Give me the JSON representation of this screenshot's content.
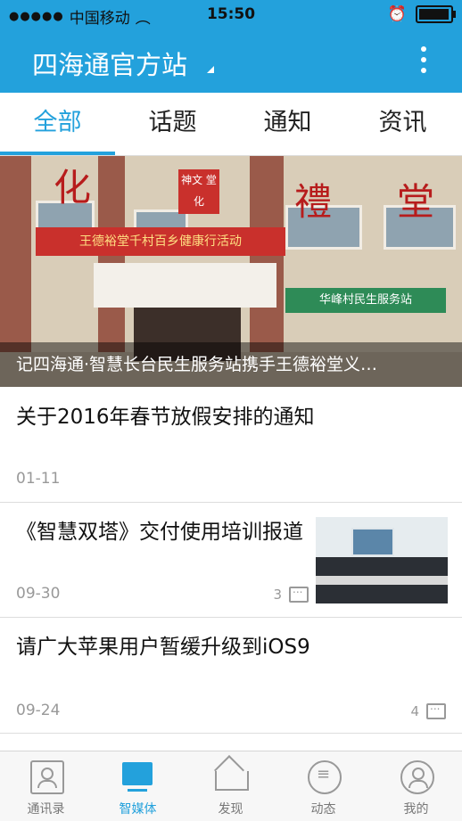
{
  "status_bar": {
    "carrier": "中国移动",
    "time": "15:50",
    "signal_icon": "signal-dots-icon",
    "wifi_icon": "wifi-icon",
    "alarm_icon": "alarm-icon",
    "battery_icon": "battery-icon"
  },
  "header": {
    "title": "四海通官方站",
    "more_icon": "more-vertical-icon"
  },
  "tabs": [
    {
      "label": "全部",
      "active": true
    },
    {
      "label": "话题",
      "active": false
    },
    {
      "label": "通知",
      "active": false
    },
    {
      "label": "资讯",
      "active": false
    }
  ],
  "banner": {
    "caption": "记四海通·智慧长台民生服务站携手王德裕堂义…",
    "sign_left": "化",
    "sign_center": "禮",
    "sign_right": "堂",
    "plaque": "神文 堂化",
    "banner_text": "王德裕堂千村百乡健康行活动",
    "green_sign": "华峰村民生服务站"
  },
  "news": [
    {
      "title": "关于2016年春节放假安排的通知",
      "date": "01-11",
      "comments": ""
    },
    {
      "title": "《智慧双塔》交付使用培训报道",
      "date": "09-30",
      "comments": "3"
    },
    {
      "title": "请广大苹果用户暂缓升级到iOS9",
      "date": "09-24",
      "comments": "4"
    }
  ],
  "tabbar": [
    {
      "label": "通讯录",
      "icon": "contacts-icon"
    },
    {
      "label": "智媒体",
      "icon": "media-icon"
    },
    {
      "label": "发现",
      "icon": "home-icon"
    },
    {
      "label": "动态",
      "icon": "chat-icon"
    },
    {
      "label": "我的",
      "icon": "profile-icon"
    }
  ],
  "colors": {
    "accent": "#23a1dc",
    "text": "#111111",
    "muted": "#999999"
  }
}
